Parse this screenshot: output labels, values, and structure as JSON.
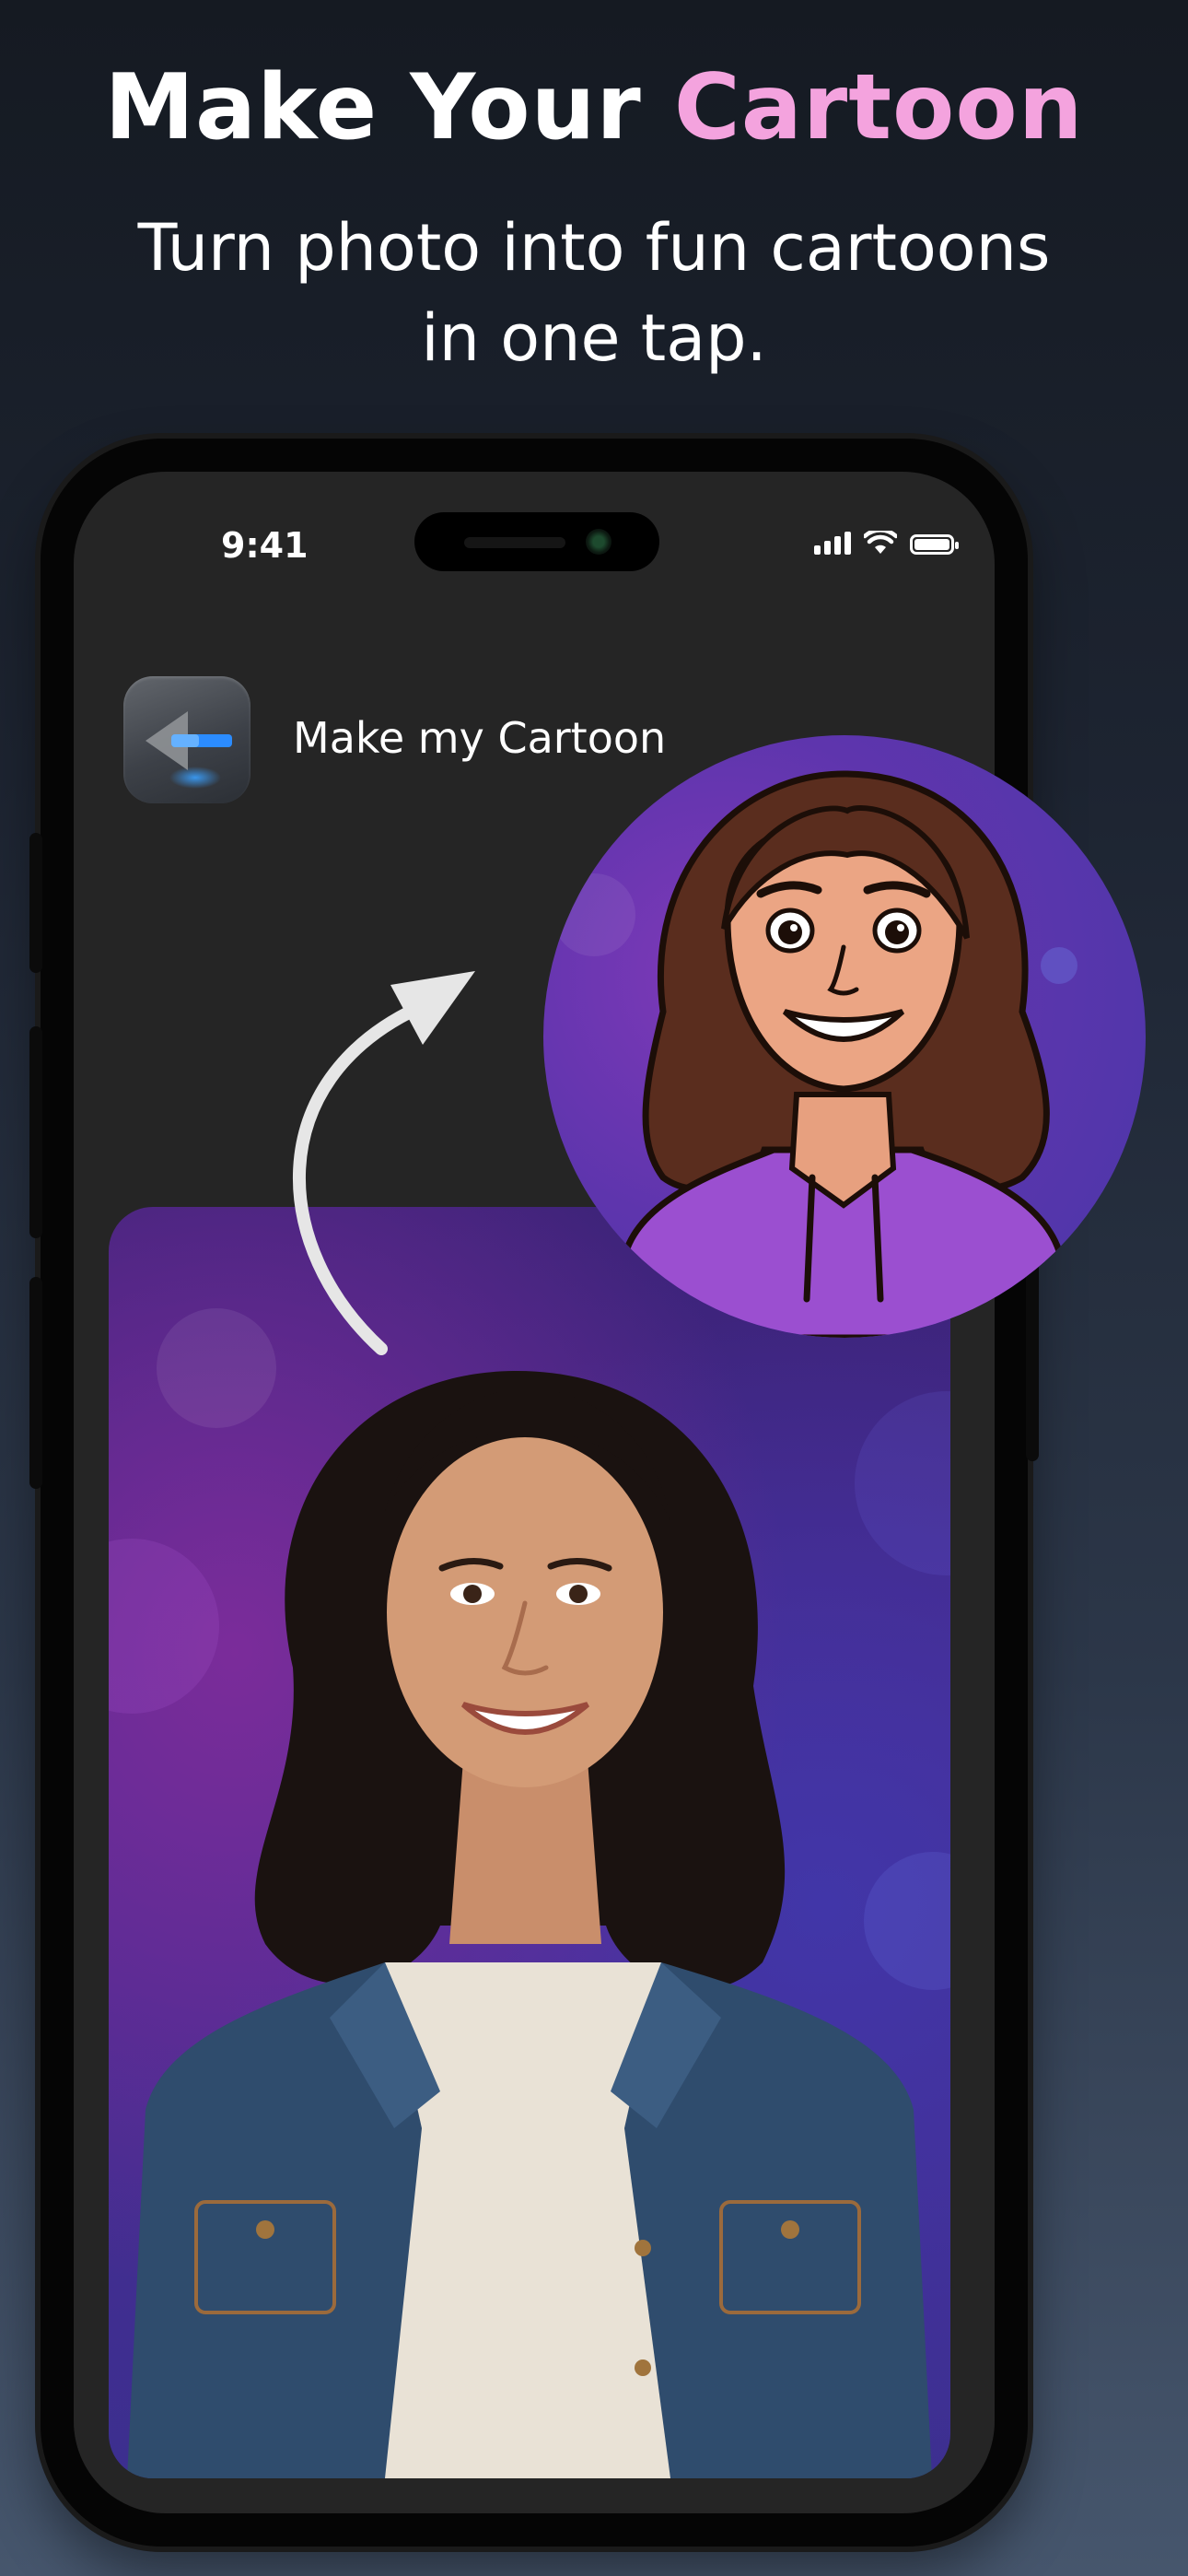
{
  "hero": {
    "title_part1": "Make Your ",
    "title_part2": "Cartoon",
    "subtitle_line1": "Turn photo into fun cartoons",
    "subtitle_line2": "in one tap."
  },
  "status_bar": {
    "time": "9:41",
    "icons": [
      "cellular-signal-icon",
      "wifi-icon",
      "battery-icon"
    ],
    "battery_level": 1.0
  },
  "app_header": {
    "icon": "back-arrow-app-icon",
    "title": "Make my Cartoon"
  },
  "images": {
    "original_photo": "portrait-photo",
    "cartoon_result": "cartoon-portrait",
    "transform_arrow": "curved-arrow-icon"
  },
  "colors": {
    "accent": "#f4a3de",
    "text": "#ffffff",
    "screen_bg": "#252525",
    "photo_bg": "#4a2b92",
    "hoodie": "#9b4fd0"
  }
}
